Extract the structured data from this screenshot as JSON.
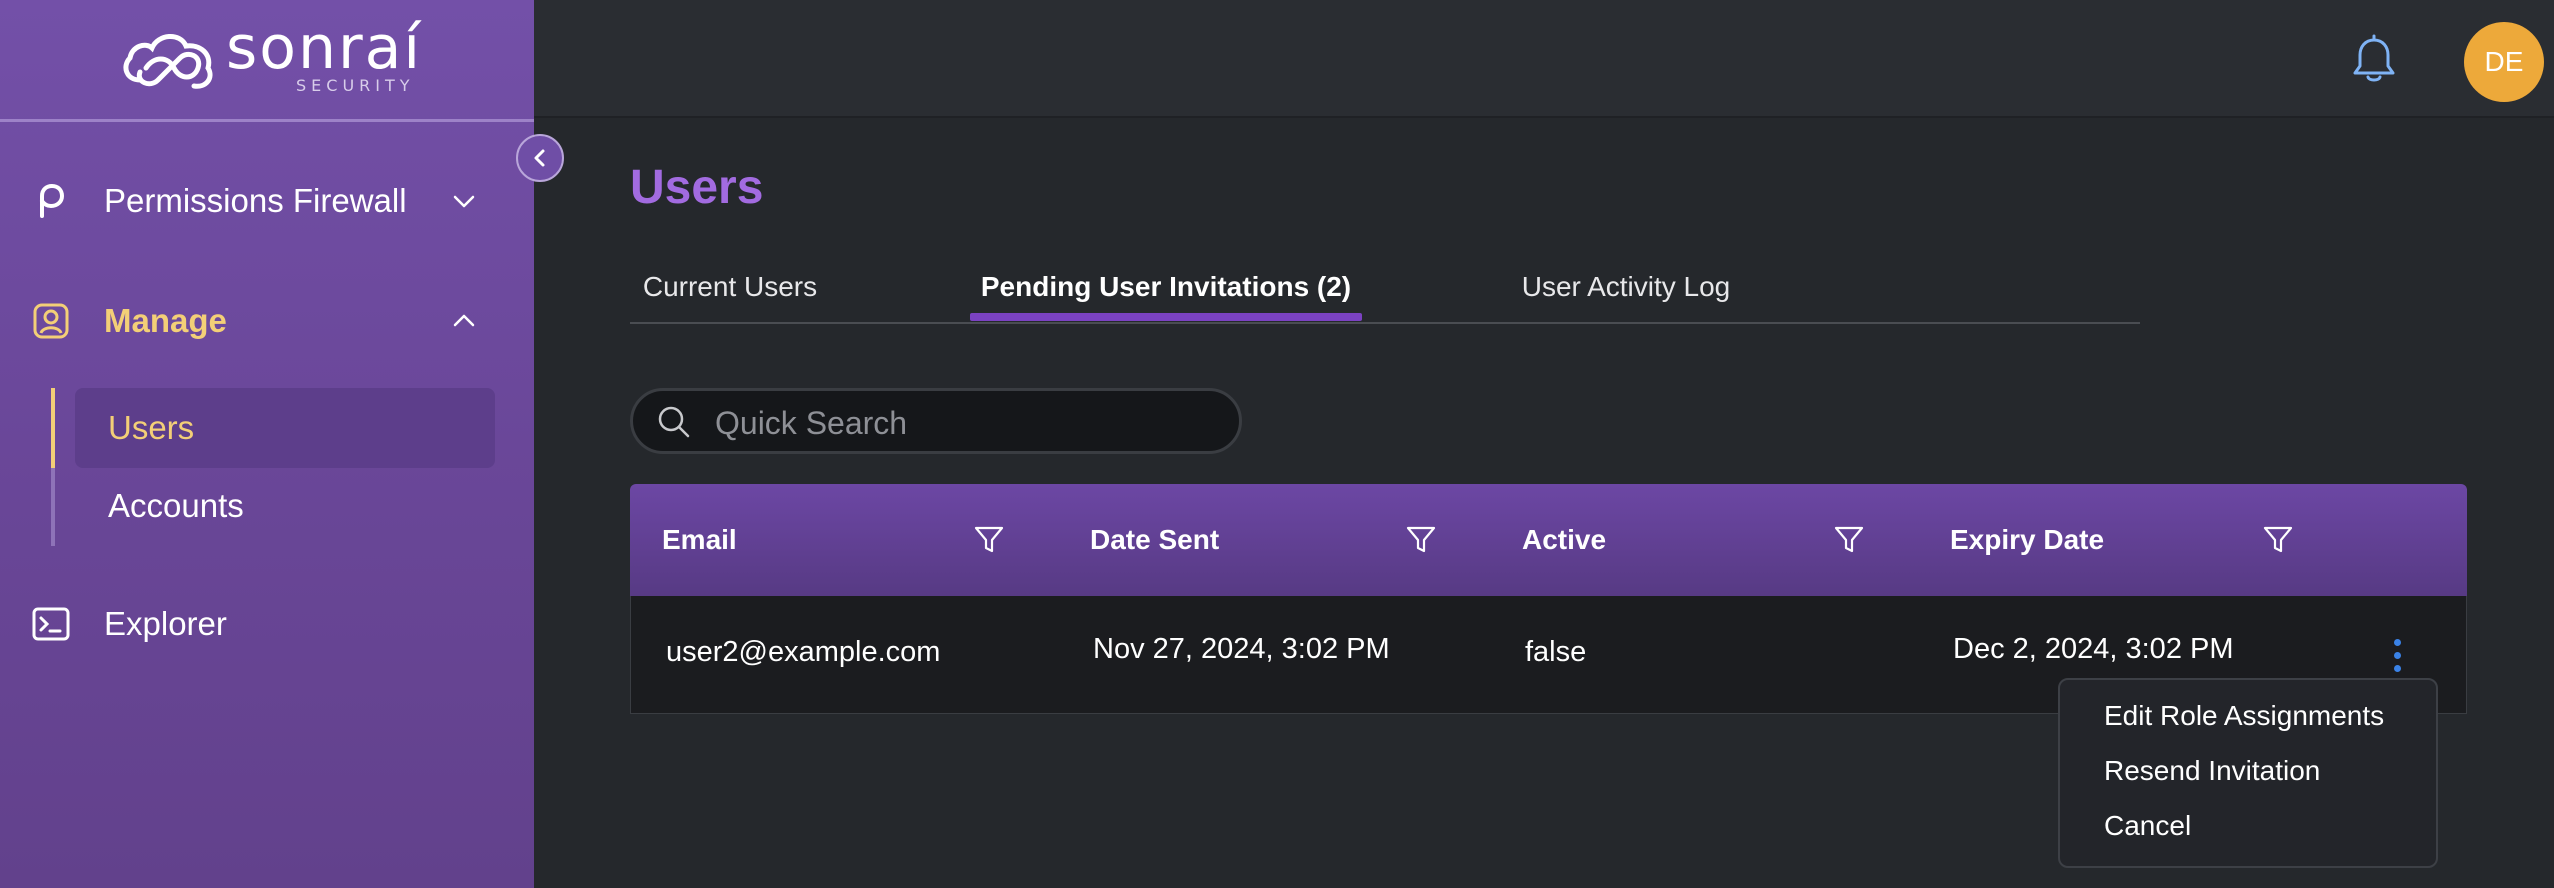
{
  "brand": {
    "name": "sonraí",
    "sub": "SECURITY"
  },
  "sidebar": {
    "items": [
      {
        "label": "Permissions Firewall",
        "icon": "permissions-firewall-icon"
      },
      {
        "label": "Manage",
        "icon": "manage-user-icon"
      },
      {
        "label": "Explorer",
        "icon": "terminal-icon"
      }
    ],
    "subitems": [
      {
        "label": "Users"
      },
      {
        "label": "Accounts"
      }
    ]
  },
  "topbar": {
    "avatar_initials": "DE"
  },
  "page": {
    "title": "Users"
  },
  "tabs": [
    {
      "label": "Current Users"
    },
    {
      "label": "Pending User Invitations (2)"
    },
    {
      "label": "User Activity Log"
    }
  ],
  "search": {
    "placeholder": "Quick Search"
  },
  "table": {
    "columns": [
      "Email",
      "Date Sent",
      "Active",
      "Expiry Date"
    ],
    "rows": [
      {
        "email": "user2@example.com",
        "date_sent": "Nov 27, 2024, 3:02 PM",
        "active": "false",
        "expiry_date": "Dec 2, 2024, 3:02 PM"
      }
    ]
  },
  "row_menu": {
    "items": [
      "Edit Role Assignments",
      "Resend Invitation",
      "Cancel"
    ]
  },
  "colors": {
    "accent_purple": "#a26be0",
    "sidebar_purple": "#6a4799",
    "active_yellow": "#f3cf77",
    "avatar_orange": "#eda93a",
    "kebab_blue": "#3a82e6"
  }
}
